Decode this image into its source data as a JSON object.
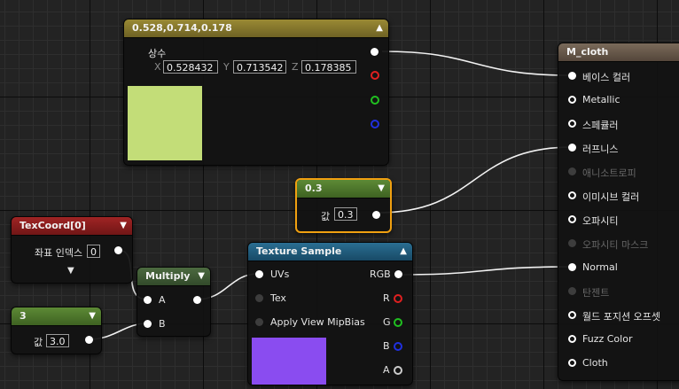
{
  "constant3": {
    "title": "0.528,0.714,0.178",
    "label": "상수",
    "x_label": "X",
    "x_value": "0.528432",
    "y_label": "Y",
    "y_value": "0.713542",
    "z_label": "Z",
    "z_value": "0.178385",
    "swatch_color": "#c3dd78"
  },
  "scalar_roughness": {
    "title": "0.3",
    "label": "값",
    "value": "0.3"
  },
  "texcoord": {
    "title": "TexCoord[0]",
    "label": "좌표 인덱스",
    "value": "0"
  },
  "multiply": {
    "title": "Multiply",
    "pin_a": "A",
    "pin_b": "B"
  },
  "scalar_three": {
    "title": "3",
    "label": "값",
    "value": "3.0"
  },
  "texture_sample": {
    "title": "Texture Sample",
    "inputs": [
      "UVs",
      "Tex",
      "Apply View MipBias"
    ],
    "outputs": [
      "RGB",
      "R",
      "G",
      "B",
      "A"
    ],
    "preview_color": "#8a4cf0"
  },
  "material": {
    "title": "M_cloth",
    "pins": [
      {
        "label": "베이스 컬러",
        "state": "connected"
      },
      {
        "label": "Metallic",
        "state": "open"
      },
      {
        "label": "스페큘러",
        "state": "open"
      },
      {
        "label": "러프니스",
        "state": "connected"
      },
      {
        "label": "애니소트로피",
        "state": "disabled"
      },
      {
        "label": "이미시브 컬러",
        "state": "open"
      },
      {
        "label": "오파시티",
        "state": "open"
      },
      {
        "label": "오파시티 마스크",
        "state": "disabled"
      },
      {
        "label": "Normal",
        "state": "connected"
      },
      {
        "label": "탄젠트",
        "state": "disabled"
      },
      {
        "label": "월드 포지션 오프셋",
        "state": "open"
      },
      {
        "label": "Fuzz Color",
        "state": "open"
      },
      {
        "label": "Cloth",
        "state": "open"
      }
    ]
  },
  "colors": {
    "vector_header": "#8a7a2c",
    "scalar_header": "#4f7a2c",
    "texcoord_header": "#8a1c1c",
    "math_header": "#3e5a33",
    "texture_header": "#1f5a7a",
    "result_header": "#6b5a4c",
    "selection_outline": "#f0a010"
  }
}
